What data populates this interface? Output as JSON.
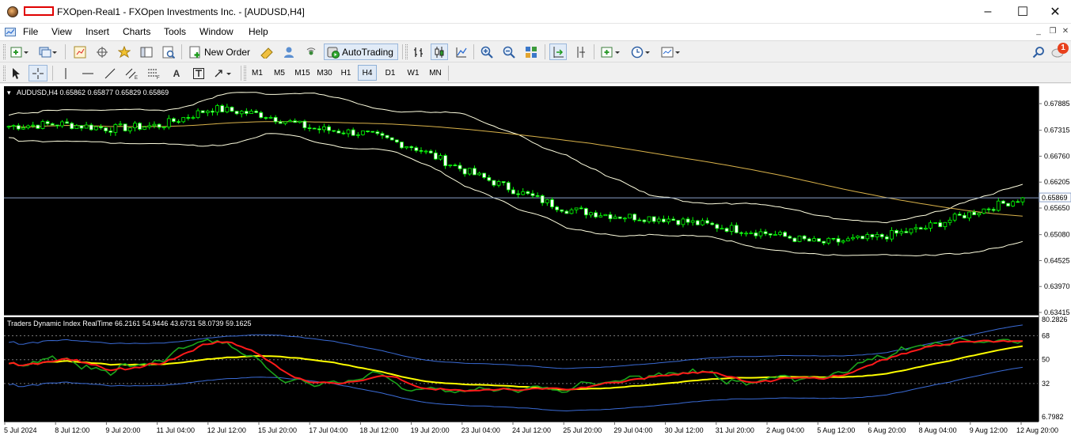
{
  "window": {
    "title": "FXOpen-Real1 - FXOpen Investments Inc. - [AUDUSD,H4]",
    "controls": {
      "minimize": "–",
      "maximize": "☐",
      "close": "✕"
    }
  },
  "menu": {
    "items": [
      "File",
      "View",
      "Insert",
      "Charts",
      "Tools",
      "Window",
      "Help"
    ],
    "mdi": {
      "minimize": "_",
      "restore": "❐",
      "close": "✕"
    }
  },
  "toolbar": {
    "new_order_label": "New Order",
    "autotrading_label": "AutoTrading",
    "notification_count": "1"
  },
  "timeframes": {
    "items": [
      "M1",
      "M5",
      "M15",
      "M30",
      "H1",
      "H4",
      "D1",
      "W1",
      "MN"
    ],
    "active": "H4"
  },
  "chart": {
    "header": "AUDUSD,H4  0.65862 0.65877 0.65829 0.65869",
    "current_price": "0.65869",
    "price_ticks": [
      "0.67885",
      "0.67315",
      "0.66760",
      "0.66205",
      "0.65650",
      "0.65080",
      "0.64525",
      "0.63970",
      "0.63415"
    ],
    "indicator_label": "Traders Dynamic Index RealTime 66.2161 54.9446 43.6731 58.0739 59.1625",
    "indicator_ticks": [
      "80.2826",
      "68",
      "50",
      "32",
      "6.7982"
    ],
    "time_ticks": [
      "5 Jul 2024",
      "8 Jul 12:00",
      "9 Jul 20:00",
      "11 Jul 04:00",
      "12 Jul 12:00",
      "15 Jul 20:00",
      "17 Jul 04:00",
      "18 Jul 12:00",
      "19 Jul 20:00",
      "23 Jul 04:00",
      "24 Jul 12:00",
      "25 Jul 20:00",
      "29 Jul 04:00",
      "30 Jul 12:00",
      "31 Jul 20:00",
      "2 Aug 04:00",
      "5 Aug 12:00",
      "6 Aug 20:00",
      "8 Aug 04:00",
      "9 Aug 12:00",
      "12 Aug 20:00"
    ],
    "colors": {
      "background": "#000000",
      "bull_candle": "#000000",
      "candle_outline": "#00ff00",
      "bollinger": "#ffffe0",
      "ma_long": "#d9b24a",
      "price_line": "#8aa0c8",
      "tdi_green": "#1aa31a",
      "tdi_red": "#ff1a1a",
      "tdi_yellow": "#ffff00",
      "tdi_blue": "#3a6bd6"
    }
  },
  "chart_data": {
    "type": "line",
    "title": "AUDUSD,H4",
    "price_path": {
      "x": [
        "5 Jul 2024",
        "8 Jul 12:00",
        "9 Jul 20:00",
        "11 Jul 04:00",
        "12 Jul 12:00",
        "15 Jul 20:00",
        "17 Jul 04:00",
        "18 Jul 12:00",
        "19 Jul 20:00",
        "23 Jul 04:00",
        "24 Jul 12:00",
        "25 Jul 20:00",
        "29 Jul 04:00",
        "30 Jul 12:00",
        "31 Jul 20:00",
        "2 Aug 04:00",
        "5 Aug 12:00",
        "6 Aug 20:00",
        "8 Aug 04:00",
        "9 Aug 12:00",
        "12 Aug 20:00"
      ],
      "y": [
        0.674,
        0.6745,
        0.6735,
        0.6742,
        0.6778,
        0.6765,
        0.6735,
        0.6725,
        0.6695,
        0.6645,
        0.6602,
        0.6562,
        0.6548,
        0.6542,
        0.6525,
        0.651,
        0.649,
        0.65,
        0.652,
        0.6555,
        0.65869
      ]
    },
    "last_close": 0.65869,
    "y_range": [
      0.63415,
      0.67885
    ],
    "indicator": {
      "name": "Traders Dynamic Index RealTime",
      "values": [
        66.2161,
        54.9446,
        43.6731,
        58.0739,
        59.1625
      ],
      "levels": [
        68,
        50,
        32
      ],
      "y_range": [
        6.7982,
        80.2826
      ]
    }
  }
}
